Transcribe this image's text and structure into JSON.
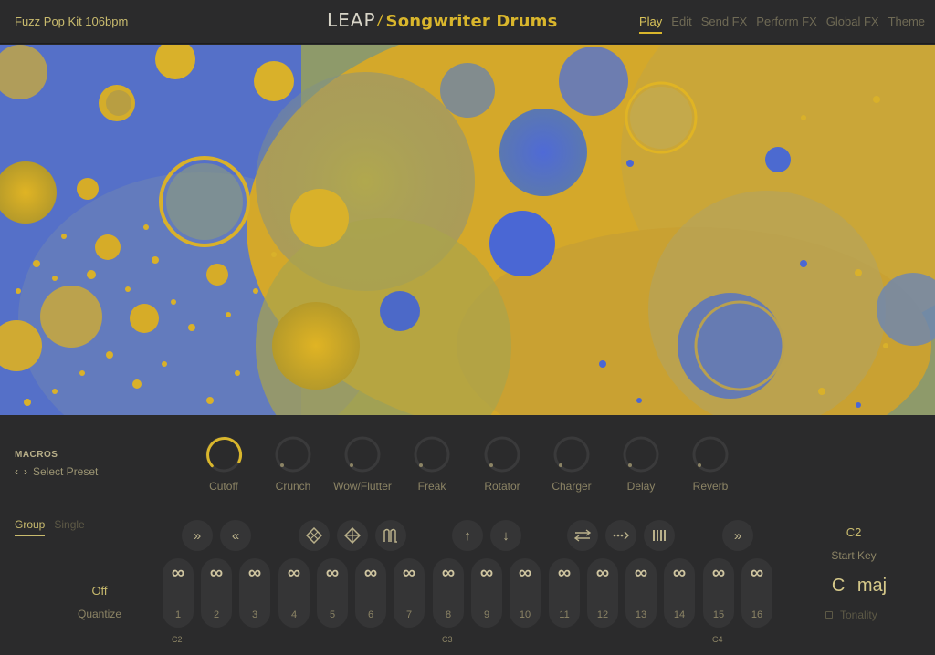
{
  "header": {
    "preset_name": "Fuzz Pop Kit 106bpm",
    "brand": "LEAP",
    "brand_separator": "/",
    "product": "Songwriter Drums",
    "tabs": [
      "Play",
      "Edit",
      "Send FX",
      "Perform FX",
      "Global FX",
      "Theme"
    ],
    "active_tab": "Play"
  },
  "macros": {
    "title": "MACROS",
    "select_preset": "Select Preset",
    "knobs": [
      {
        "label": "Cutoff",
        "value": 0.85,
        "active": true
      },
      {
        "label": "Crunch",
        "value": 0.0,
        "active": false
      },
      {
        "label": "Wow/Flutter",
        "value": 0.0,
        "active": false
      },
      {
        "label": "Freak",
        "value": 0.0,
        "active": false
      },
      {
        "label": "Rotator",
        "value": 0.0,
        "active": false
      },
      {
        "label": "Charger",
        "value": 0.0,
        "active": false
      },
      {
        "label": "Delay",
        "value": 0.0,
        "active": false
      },
      {
        "label": "Reverb",
        "value": 0.0,
        "active": false
      }
    ]
  },
  "mode": {
    "tabs": [
      "Group",
      "Single"
    ],
    "active": "Group"
  },
  "controls": {
    "icons": [
      "fast-forward-icon",
      "rewind-icon",
      "grid-diamond-icon",
      "grid-diamond-alt-icon",
      "envelope-icon",
      "arrow-up-icon",
      "arrow-down-icon",
      "swap-icon",
      "shuffle-dots-icon",
      "bars-icon",
      "fast-forward-icon"
    ]
  },
  "pads": {
    "loop_glyph": "∞",
    "numbers": [
      "1",
      "2",
      "3",
      "4",
      "5",
      "6",
      "7",
      "8",
      "9",
      "10",
      "11",
      "12",
      "13",
      "14",
      "15",
      "16"
    ],
    "octave_labels": [
      "C2",
      "C3",
      "C4"
    ]
  },
  "quantize": {
    "value": "Off",
    "label": "Quantize"
  },
  "start_key": {
    "value": "C2",
    "label": "Start Key"
  },
  "tonality": {
    "value": "C  maj",
    "label": "Tonality"
  },
  "colors": {
    "accent": "#d9b62c",
    "background": "#2b2b2c",
    "art_blue": "#4b67d0",
    "art_yellow": "#d9a925"
  }
}
